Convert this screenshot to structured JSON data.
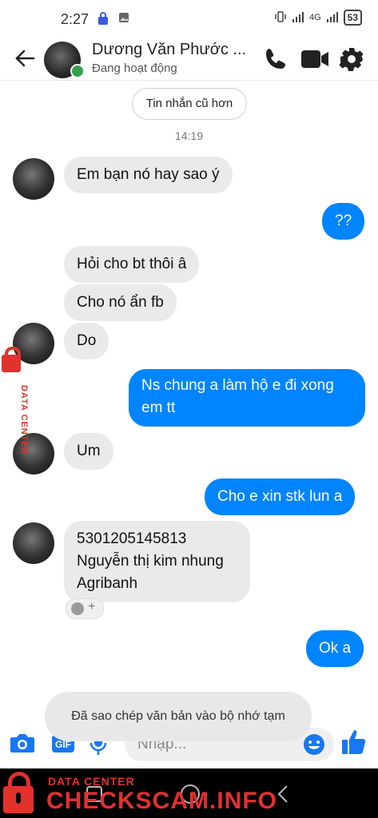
{
  "status_bar": {
    "time": "2:27",
    "battery": "53",
    "network": "4G"
  },
  "header": {
    "name": "Dương Văn Phước ...",
    "status": "Đang hoạt động"
  },
  "conversation": {
    "older_button": "Tin nhắn cũ hơn",
    "timestamp": "14:19",
    "messages": [
      {
        "dir": "in",
        "text": "Em bạn nó hay sao ý"
      },
      {
        "dir": "out",
        "text": "??"
      },
      {
        "dir": "in",
        "text": "Hỏi cho bt thôi â"
      },
      {
        "dir": "in",
        "text": "Cho nó ẩn fb"
      },
      {
        "dir": "in",
        "text": "Do"
      },
      {
        "dir": "out",
        "lines": [
          "Ns chung a làm hộ e đi xong",
          "em tt"
        ]
      },
      {
        "dir": "in",
        "text": "Um"
      },
      {
        "dir": "out",
        "text": "Cho e xin stk lun a"
      },
      {
        "dir": "in",
        "lines": [
          "5301205145813",
          "Nguyễn thị kim nhung",
          "Agribanh"
        ]
      },
      {
        "dir": "out",
        "text": "Ok a"
      }
    ]
  },
  "toast": "Đã sao chép văn bản vào bộ nhớ tạm",
  "composer": {
    "placeholder": "Nhập..."
  },
  "watermark": {
    "line1": "DATA CENTER",
    "line2": "CHECKSCAM.INFO"
  },
  "colors": {
    "messenger_blue": "#0084ff",
    "incoming_bubble": "#eaeaea",
    "watermark_red": "#e3312b"
  }
}
